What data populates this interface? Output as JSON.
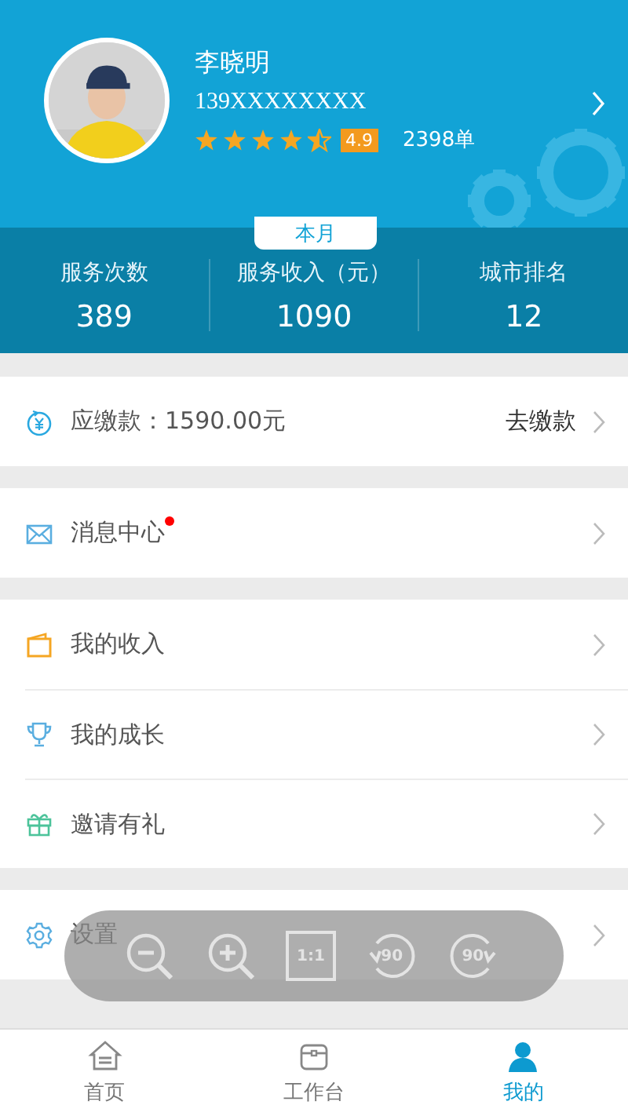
{
  "profile": {
    "name": "李晓明",
    "phone": "139XXXXXXXX",
    "stars": 4.5,
    "rating": "4.9",
    "orders": "2398单"
  },
  "period_tab": {
    "label": "本月"
  },
  "stats": [
    {
      "label": "服务次数",
      "value": "389"
    },
    {
      "label": "服务收入（元）",
      "value": "1090"
    },
    {
      "label": "城市排名",
      "value": "12"
    }
  ],
  "menu_groups": [
    {
      "items": [
        {
          "kind": "payment",
          "label": "应缴款：1590.00元",
          "action": "去缴款",
          "unread": false
        }
      ]
    },
    {
      "items": [
        {
          "kind": "messages",
          "label": "消息中心",
          "unread": true
        }
      ]
    },
    {
      "items": [
        {
          "kind": "income",
          "label": "我的收入",
          "unread": false
        },
        {
          "kind": "growth",
          "label": "我的成长",
          "unread": false
        },
        {
          "kind": "invite",
          "label": "邀请有礼",
          "unread": false
        }
      ]
    },
    {
      "items": [
        {
          "kind": "settings",
          "label": "设置",
          "unread": false
        }
      ]
    }
  ],
  "tab_bar": [
    {
      "kind": "home",
      "label": "首页",
      "selected": false
    },
    {
      "kind": "workbench",
      "label": "工作台",
      "selected": false
    },
    {
      "kind": "mine",
      "label": "我的",
      "selected": true
    }
  ],
  "viewer_toolbar": [
    {
      "kind": "zoom-out"
    },
    {
      "kind": "zoom-in"
    },
    {
      "kind": "actual-size",
      "text": "1:1"
    },
    {
      "kind": "rotate-left",
      "text": "90"
    },
    {
      "kind": "rotate-right",
      "text": "90"
    }
  ]
}
